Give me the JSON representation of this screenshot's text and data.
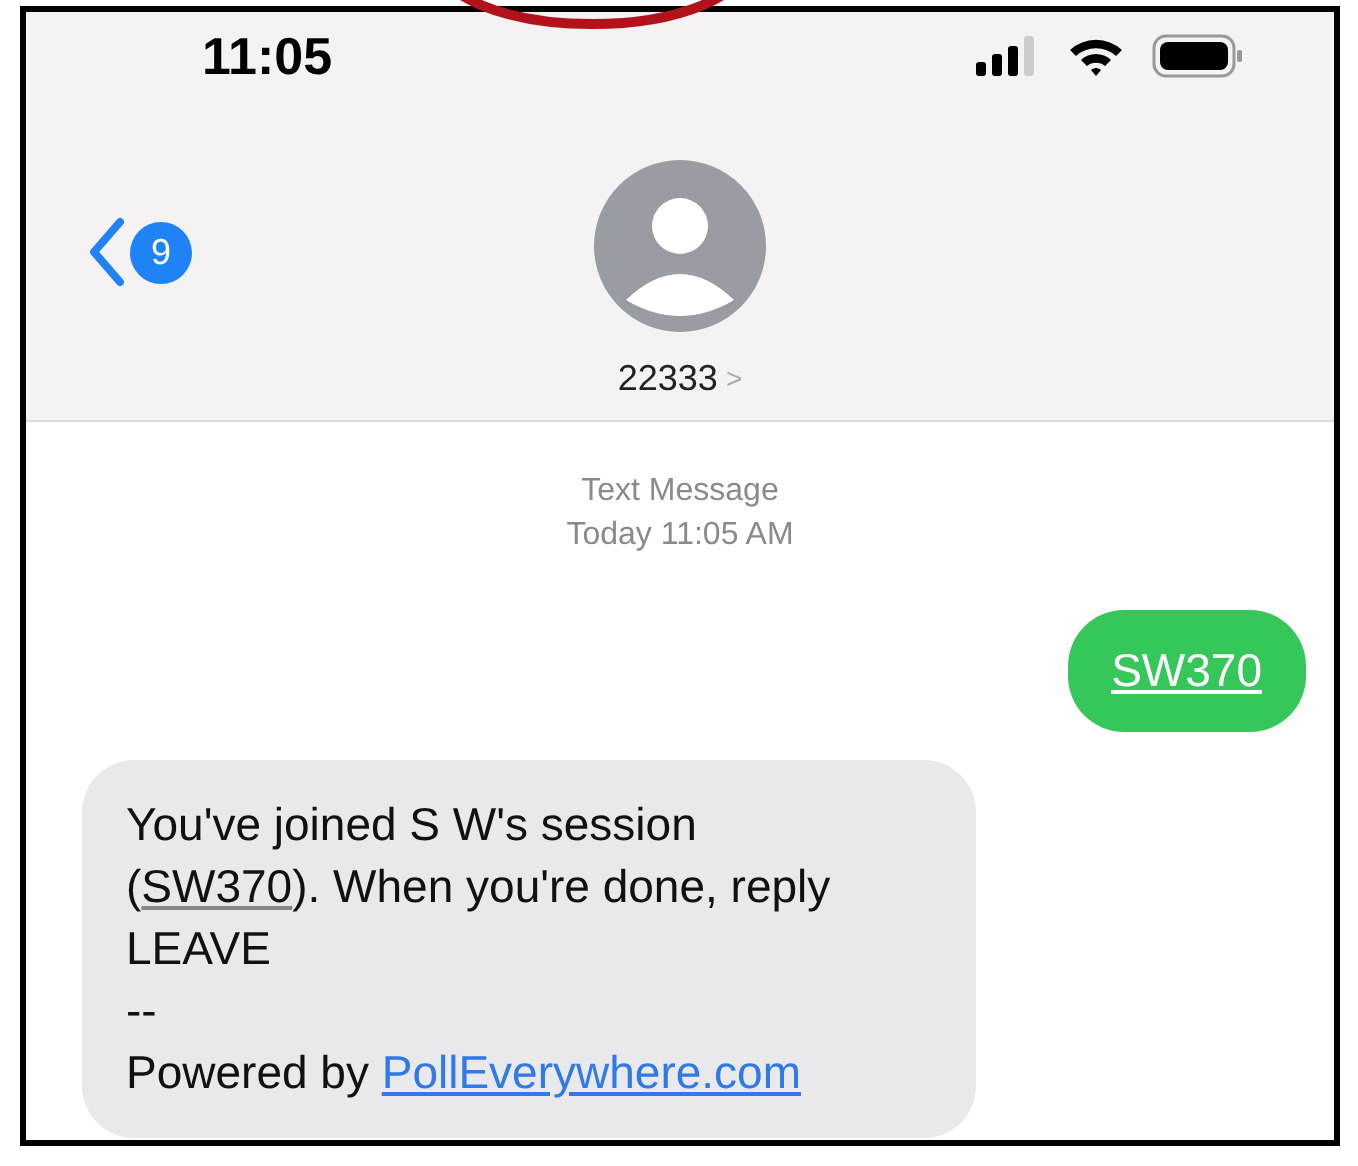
{
  "status_bar": {
    "time": "11:05"
  },
  "header": {
    "back_badge": "9",
    "contact": "22333",
    "contact_chevron": ">"
  },
  "timestamp": {
    "label": "Text Message",
    "time": "Today 11:05 AM"
  },
  "messages": [
    {
      "kind": "sent",
      "segments": [
        {
          "kind": "code",
          "text": "SW370"
        }
      ]
    },
    {
      "kind": "received",
      "segments": [
        {
          "kind": "text",
          "text": "You've joined S W's session"
        },
        {
          "kind": "break"
        },
        {
          "kind": "text",
          "text": "("
        },
        {
          "kind": "code",
          "text": "SW370"
        },
        {
          "kind": "text",
          "text": "). When you're done, reply"
        },
        {
          "kind": "break"
        },
        {
          "kind": "text",
          "text": "LEAVE"
        },
        {
          "kind": "break"
        },
        {
          "kind": "text",
          "text": "--"
        },
        {
          "kind": "break"
        },
        {
          "kind": "text",
          "text": "Powered by "
        },
        {
          "kind": "link",
          "text": "PollEverywhere.com"
        }
      ]
    }
  ]
}
